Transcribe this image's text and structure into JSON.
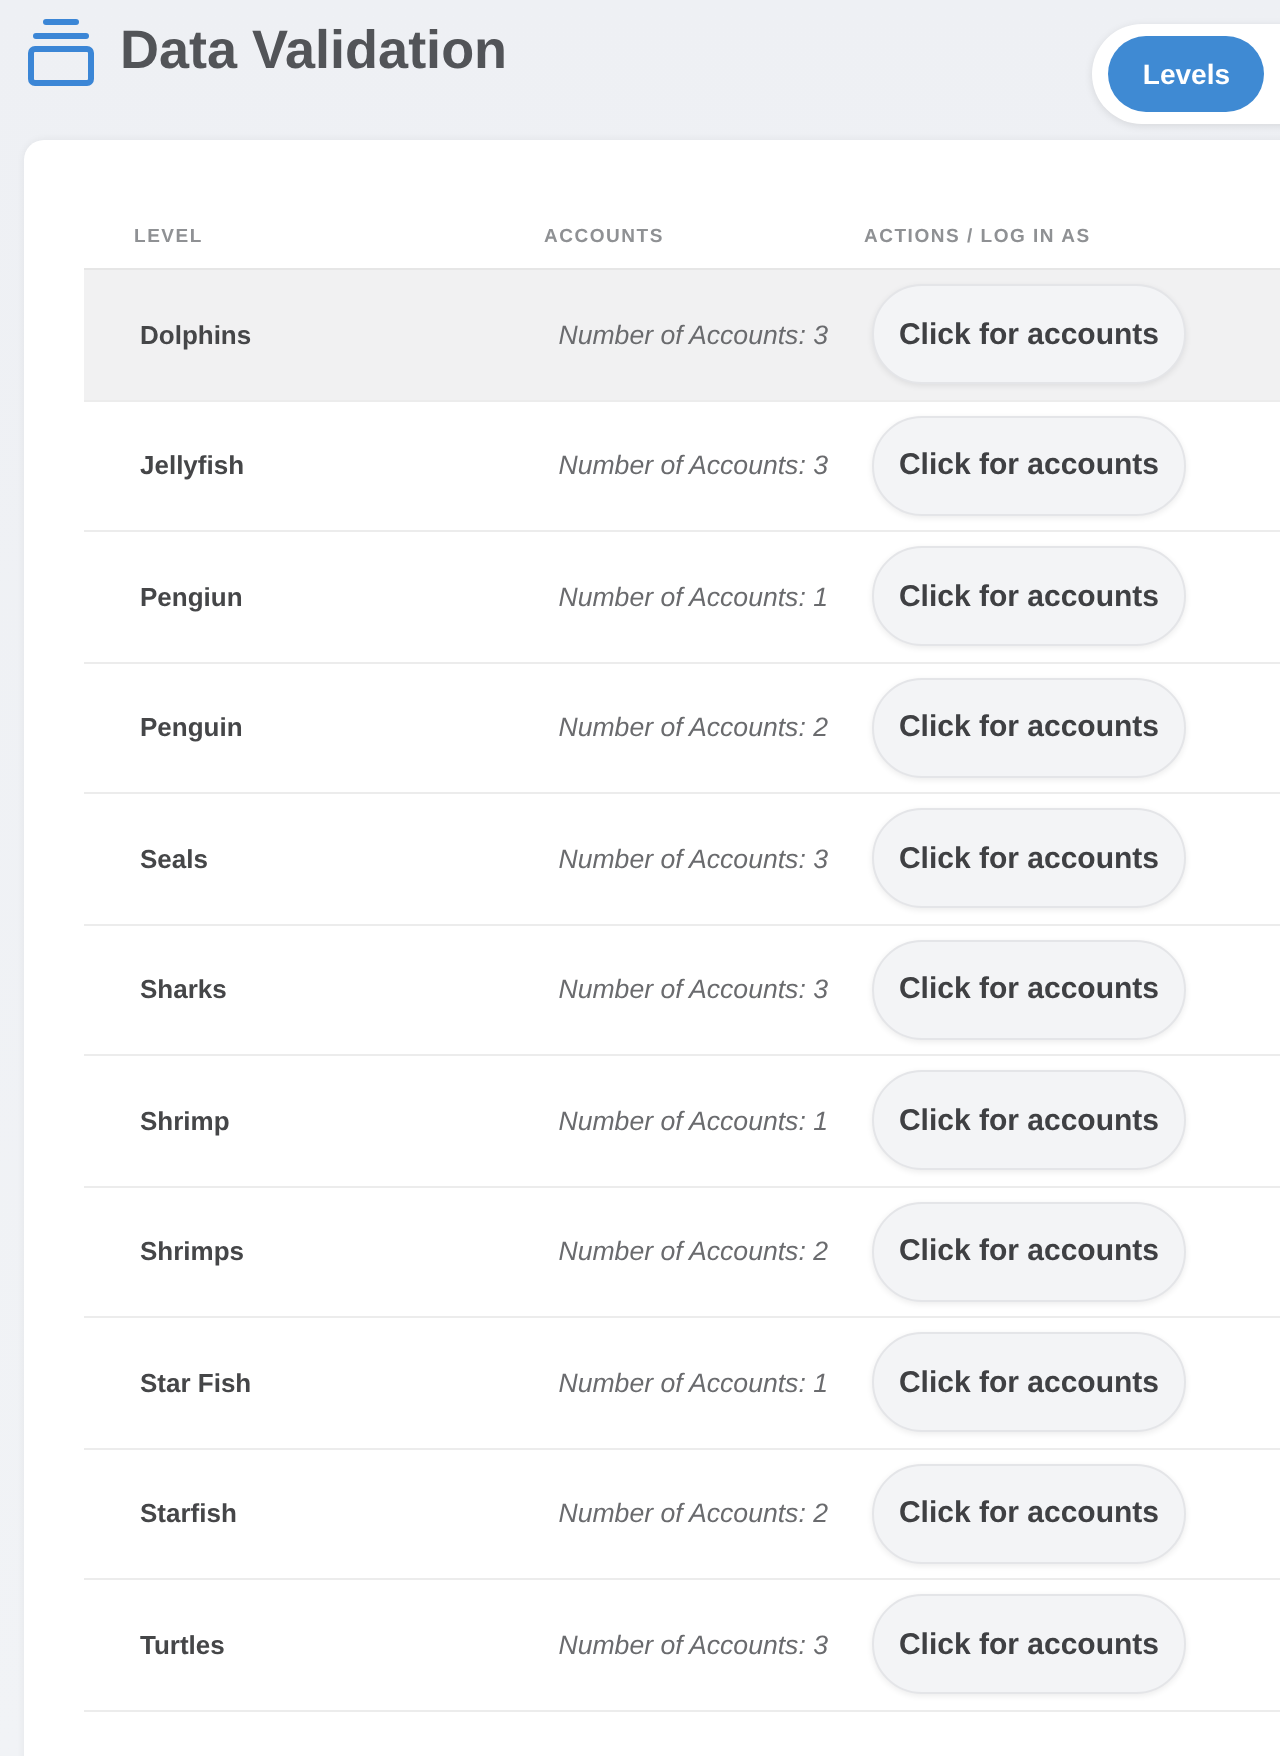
{
  "header": {
    "title": "Data Validation",
    "view_toggle": [
      {
        "label": "Levels",
        "selected": true
      }
    ]
  },
  "table": {
    "columns": [
      "LEVEL",
      "ACCOUNTS",
      "ACTIONS / LOG IN AS"
    ],
    "rows": [
      {
        "level": "Dolphins",
        "accounts": "Number of Accounts: 3",
        "action": "Click for accounts",
        "hovered": true
      },
      {
        "level": "Jellyfish",
        "accounts": "Number of Accounts: 3",
        "action": "Click for accounts",
        "hovered": false
      },
      {
        "level": "Pengiun",
        "accounts": "Number of Accounts: 1",
        "action": "Click for accounts",
        "hovered": false
      },
      {
        "level": "Penguin",
        "accounts": "Number of Accounts: 2",
        "action": "Click for accounts",
        "hovered": false
      },
      {
        "level": "Seals",
        "accounts": "Number of Accounts: 3",
        "action": "Click for accounts",
        "hovered": false
      },
      {
        "level": "Sharks",
        "accounts": "Number of Accounts: 3",
        "action": "Click for accounts",
        "hovered": false
      },
      {
        "level": "Shrimp",
        "accounts": "Number of Accounts: 1",
        "action": "Click for accounts",
        "hovered": false
      },
      {
        "level": "Shrimps",
        "accounts": "Number of Accounts: 2",
        "action": "Click for accounts",
        "hovered": false
      },
      {
        "level": "Star Fish",
        "accounts": "Number of Accounts: 1",
        "action": "Click for accounts",
        "hovered": false
      },
      {
        "level": "Starfish",
        "accounts": "Number of Accounts: 2",
        "action": "Click for accounts",
        "hovered": false
      },
      {
        "level": "Turtles",
        "accounts": "Number of Accounts: 3",
        "action": "Click for accounts",
        "hovered": false
      }
    ]
  }
}
